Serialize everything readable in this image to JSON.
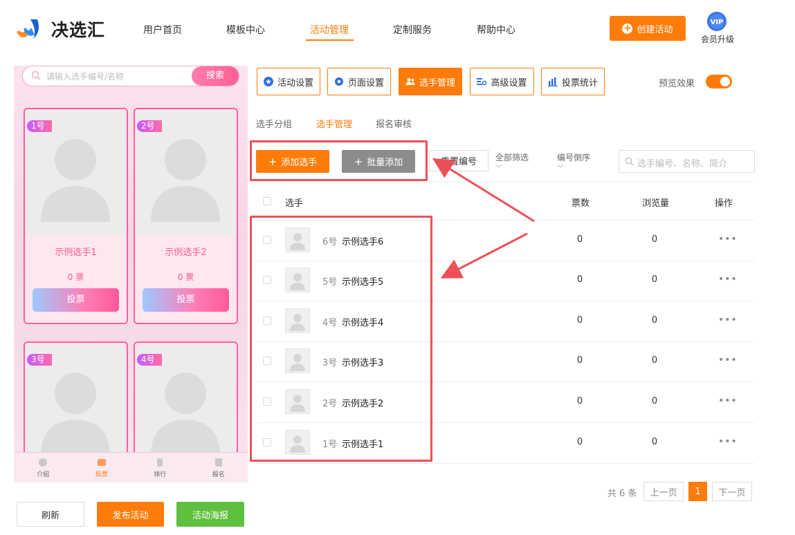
{
  "header": {
    "logo_text": "决选汇",
    "nav": [
      "用户首页",
      "模板中心",
      "活动管理",
      "定制服务",
      "帮助中心"
    ],
    "active_nav": "活动管理",
    "create_button": "创建活动",
    "vip_badge": "VIP",
    "vip_label": "会员升级"
  },
  "preview": {
    "search_placeholder": "请输入选手编号/名称",
    "search_button": "搜索",
    "cards": [
      {
        "num": "1号",
        "name": "示例选手1",
        "votes": "0 票",
        "vote_button": "投票"
      },
      {
        "num": "2号",
        "name": "示例选手2",
        "votes": "0 票",
        "vote_button": "投票"
      },
      {
        "num": "3号"
      },
      {
        "num": "4号"
      }
    ],
    "tabs": [
      {
        "label": "介绍",
        "icon": "heart-face-icon"
      },
      {
        "label": "投票",
        "icon": "vote-icon"
      },
      {
        "label": "排行",
        "icon": "rank-icon"
      },
      {
        "label": "报名",
        "icon": "signup-icon"
      }
    ],
    "active_tab": "投票"
  },
  "bottom_buttons": {
    "refresh": "刷新",
    "publish": "发布活动",
    "poster": "活动海报"
  },
  "toolbar": {
    "buttons": [
      {
        "label": "活动设置",
        "icon": "star-icon"
      },
      {
        "label": "页面设置",
        "icon": "gear-icon"
      },
      {
        "label": "选手管理",
        "icon": "users-icon"
      },
      {
        "label": "高级设置",
        "icon": "advanced-settings-icon"
      },
      {
        "label": "投票统计",
        "icon": "bar-chart-icon"
      }
    ],
    "active": "选手管理",
    "preview_label": "预览效果",
    "preview_on": true
  },
  "subtabs": [
    "选手分组",
    "选手管理",
    "报名审核"
  ],
  "active_subtab": "选手管理",
  "actions": {
    "add": "添加选手",
    "batch_add": "批量添加",
    "reset_numbers": "重置编号",
    "filter_all": "全部筛选",
    "sort_desc": "编号倒序",
    "search_placeholder": "选手编号、名称、简介"
  },
  "table": {
    "headers": {
      "player": "选手",
      "votes": "票数",
      "views": "浏览量",
      "ops": "操作"
    },
    "rows": [
      {
        "num": "6号",
        "name": "示例选手6",
        "votes": "0",
        "views": "0",
        "ops": "•••"
      },
      {
        "num": "5号",
        "name": "示例选手5",
        "votes": "0",
        "views": "0",
        "ops": "•••"
      },
      {
        "num": "4号",
        "name": "示例选手4",
        "votes": "0",
        "views": "0",
        "ops": "•••"
      },
      {
        "num": "3号",
        "name": "示例选手3",
        "votes": "0",
        "views": "0",
        "ops": "•••"
      },
      {
        "num": "2号",
        "name": "示例选手2",
        "votes": "0",
        "views": "0",
        "ops": "•••"
      },
      {
        "num": "1号",
        "name": "示例选手1",
        "votes": "0",
        "views": "0",
        "ops": "•••"
      }
    ]
  },
  "pagination": {
    "total": "共 6 条",
    "prev": "上一页",
    "current": "1",
    "next": "下一页"
  },
  "colors": {
    "accent": "#ff7c0a",
    "annotation": "#ee4f57",
    "preview_pink": "#ff5b8f"
  }
}
